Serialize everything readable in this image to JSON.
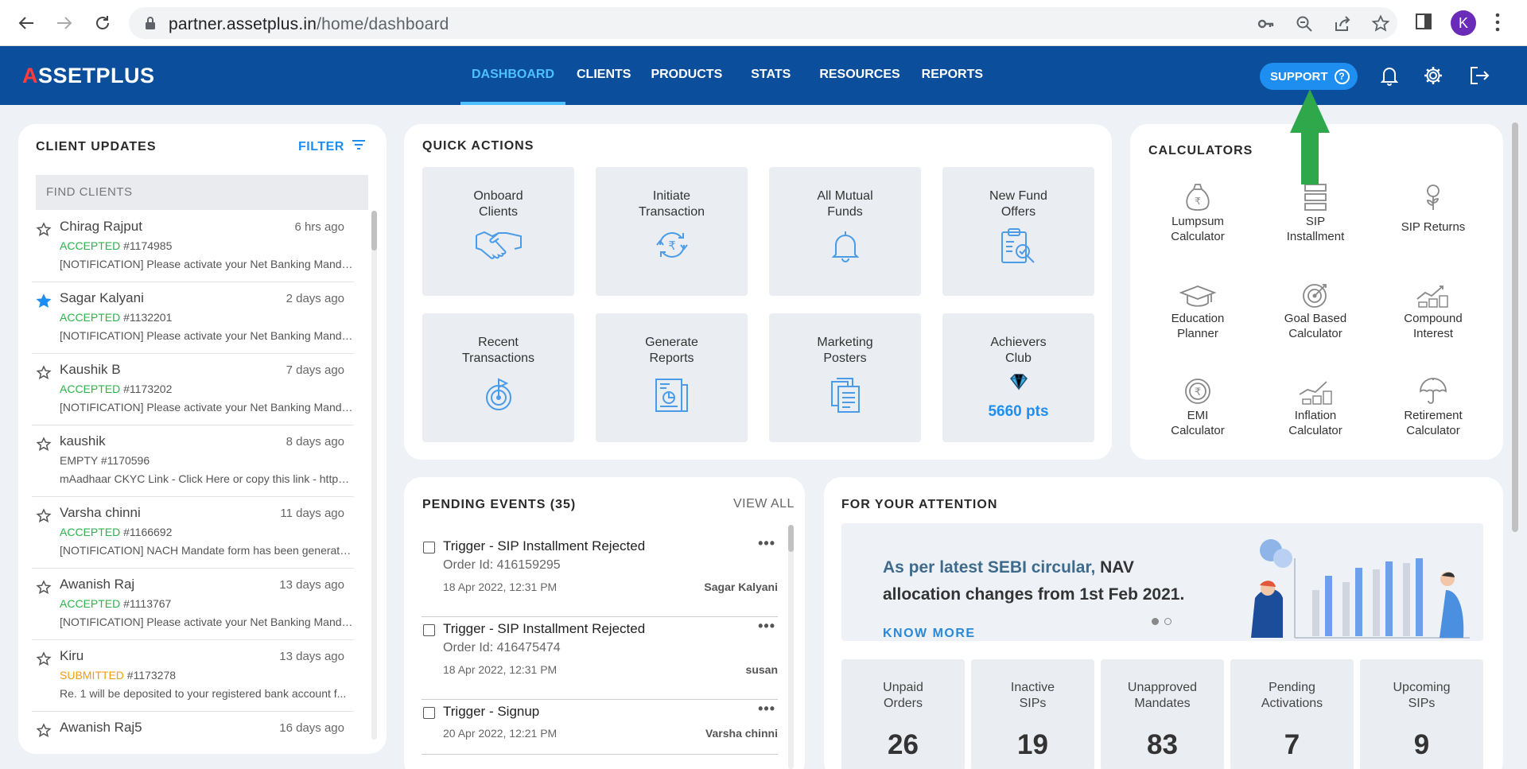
{
  "browser": {
    "url_host": "partner.assetplus.in",
    "url_path": "/home/dashboard",
    "profile_initial": "K"
  },
  "header": {
    "logo_prefix": "A",
    "logo_rest": "SSETPLUS",
    "nav": [
      "DASHBOARD",
      "CLIENTS",
      "PRODUCTS",
      "STATS",
      "RESOURCES",
      "REPORTS"
    ],
    "active_nav": "DASHBOARD",
    "support_label": "SUPPORT"
  },
  "client_updates": {
    "title": "CLIENT UPDATES",
    "filter_label": "FILTER",
    "search_placeholder": "FIND CLIENTS",
    "items": [
      {
        "name": "Chirag Rajput",
        "time": "6 hrs ago",
        "status": "ACCEPTED",
        "status_color": "#2db34a",
        "id": "#1174985",
        "note": "[NOTIFICATION] Please activate your Net Banking Manda...",
        "starred": false
      },
      {
        "name": "Sagar Kalyani",
        "time": "2 days ago",
        "status": "ACCEPTED",
        "status_color": "#2db34a",
        "id": "#1132201",
        "note": "[NOTIFICATION] Please activate your Net Banking Manda...",
        "starred": true
      },
      {
        "name": "Kaushik B",
        "time": "7 days ago",
        "status": "ACCEPTED",
        "status_color": "#2db34a",
        "id": "#1173202",
        "note": "[NOTIFICATION] Please activate your Net Banking Manda...",
        "starred": false
      },
      {
        "name": "kaushik",
        "time": "8 days ago",
        "status": "EMPTY",
        "status_color": "#555555",
        "id": "#1170596",
        "note": "mAadhaar CKYC Link - Click Here or copy this link - https:...",
        "starred": false
      },
      {
        "name": "Varsha chinni",
        "time": "11 days ago",
        "status": "ACCEPTED",
        "status_color": "#2db34a",
        "id": "#1166692",
        "note": "[NOTIFICATION] NACH Mandate form has been generate...",
        "starred": false
      },
      {
        "name": "Awanish Raj",
        "time": "13 days ago",
        "status": "ACCEPTED",
        "status_color": "#2db34a",
        "id": "#1113767",
        "note": "[NOTIFICATION] Please activate your Net Banking Manda...",
        "starred": false
      },
      {
        "name": "Kiru",
        "time": "13 days ago",
        "status": "SUBMITTED",
        "status_color": "#f39c12",
        "id": "#1173278",
        "note": "Re. 1 will be deposited to your registered bank account f...",
        "starred": false
      },
      {
        "name": "Awanish Raj5",
        "time": "16 days ago",
        "status": "",
        "status_color": "#555555",
        "id": "",
        "note": "",
        "starred": false
      }
    ]
  },
  "quick_actions": {
    "title": "QUICK ACTIONS",
    "tiles": [
      {
        "label": "Onboard\nClients",
        "icon": "handshake-icon"
      },
      {
        "label": "Initiate\nTransaction",
        "icon": "rupee-cycle-icon"
      },
      {
        "label": "All Mutual\nFunds",
        "icon": "bell-icon"
      },
      {
        "label": "New Fund\nOffers",
        "icon": "clipboard-search-icon"
      },
      {
        "label": "Recent\nTransactions",
        "icon": "target-flag-icon"
      },
      {
        "label": "Generate\nReports",
        "icon": "report-chart-icon"
      },
      {
        "label": "Marketing\nPosters",
        "icon": "documents-icon"
      },
      {
        "label": "Achievers\nClub",
        "icon": "diamond-icon"
      }
    ],
    "achievers_points": "5660 pts"
  },
  "calculators": {
    "title": "CALCULATORS",
    "items": [
      {
        "label": "Lumpsum\nCalculator",
        "icon": "money-bag-icon"
      },
      {
        "label": "SIP\nInstallment",
        "icon": "stack-icon"
      },
      {
        "label": "SIP Returns",
        "icon": "plant-coin-icon"
      },
      {
        "label": "Education\nPlanner",
        "icon": "graduation-cap-icon"
      },
      {
        "label": "Goal Based\nCalculator",
        "icon": "target-icon"
      },
      {
        "label": "Compound\nInterest",
        "icon": "growth-coins-icon"
      },
      {
        "label": "EMI\nCalculator",
        "icon": "coin-icon"
      },
      {
        "label": "Inflation\nCalculator",
        "icon": "inflation-coins-icon"
      },
      {
        "label": "Retirement\nCalculator",
        "icon": "umbrella-icon"
      }
    ]
  },
  "pending_events": {
    "title": "PENDING EVENTS (35)",
    "view_all": "VIEW ALL",
    "items": [
      {
        "title": "Trigger - SIP Installment Rejected",
        "order": "Order Id: 416159295",
        "date": "18 Apr 2022, 12:31 PM",
        "who": "Sagar Kalyani"
      },
      {
        "title": "Trigger - SIP Installment Rejected",
        "order": "Order Id: 416475474",
        "date": "18 Apr 2022, 12:31 PM",
        "who": "susan"
      },
      {
        "title": "Trigger - Signup",
        "order": "",
        "date": "20 Apr 2022, 12:21 PM",
        "who": "Varsha chinni"
      }
    ]
  },
  "attention": {
    "title": "FOR YOUR ATTENTION",
    "banner_prefix": "As per latest SEBI circular,",
    "banner_highlight": "NAV",
    "banner_line2": "allocation changes from 1st Feb 2021.",
    "know_more": "KNOW MORE",
    "stats": [
      {
        "label": "Unpaid\nOrders",
        "value": "26"
      },
      {
        "label": "Inactive\nSIPs",
        "value": "19"
      },
      {
        "label": "Unapproved\nMandates",
        "value": "83"
      },
      {
        "label": "Pending\nActivations",
        "value": "7"
      },
      {
        "label": "Upcoming\nSIPs",
        "value": "9"
      }
    ]
  },
  "colors": {
    "header_bg": "#0b4e9b",
    "accent": "#1e8ff0",
    "active_nav": "#4fc0ff",
    "arrow": "#2ea84a"
  }
}
